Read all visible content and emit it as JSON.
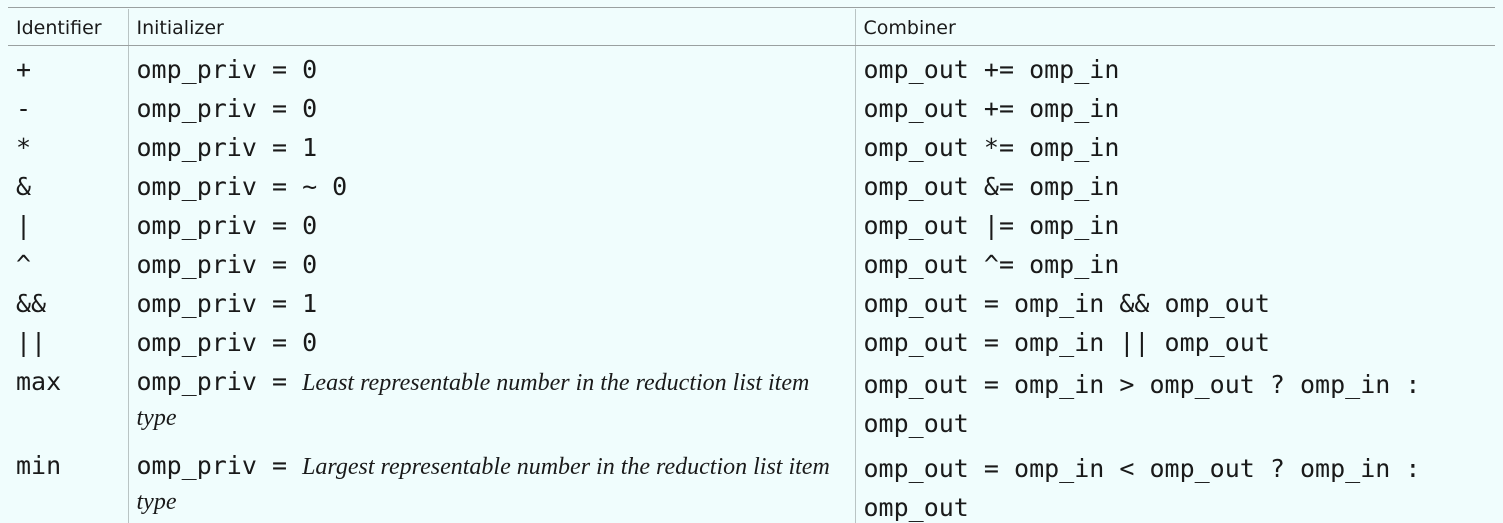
{
  "table": {
    "headers": {
      "identifier": "Identifier",
      "initializer": "Initializer",
      "combiner": "Combiner"
    },
    "rows": [
      {
        "identifier": "+",
        "init_code": "omp_priv = 0",
        "init_desc": "",
        "combiner": "omp_out += omp_in"
      },
      {
        "identifier": "-",
        "init_code": "omp_priv = 0",
        "init_desc": "",
        "combiner": "omp_out += omp_in"
      },
      {
        "identifier": "*",
        "init_code": "omp_priv = 1",
        "init_desc": "",
        "combiner": "omp_out *= omp_in"
      },
      {
        "identifier": "&",
        "init_code": "omp_priv = ~ 0",
        "init_desc": "",
        "combiner": "omp_out &= omp_in"
      },
      {
        "identifier": "|",
        "init_code": "omp_priv = 0",
        "init_desc": "",
        "combiner": "omp_out |= omp_in"
      },
      {
        "identifier": "^",
        "init_code": "omp_priv = 0",
        "init_desc": "",
        "combiner": "omp_out ^= omp_in"
      },
      {
        "identifier": "&&",
        "init_code": "omp_priv = 1",
        "init_desc": "",
        "combiner": "omp_out = omp_in && omp_out"
      },
      {
        "identifier": "||",
        "init_code": "omp_priv = 0",
        "init_desc": "",
        "combiner": "omp_out = omp_in || omp_out"
      },
      {
        "identifier": "max",
        "init_code": "omp_priv =",
        "init_desc": "Least representable number in the reduction list item type",
        "combiner": "omp_out = omp_in > omp_out ? omp_in : omp_out"
      },
      {
        "identifier": "min",
        "init_code": "omp_priv =",
        "init_desc": "Largest representable number in the reduction list item type",
        "combiner": "omp_out = omp_in < omp_out ? omp_in : omp_out"
      }
    ]
  }
}
